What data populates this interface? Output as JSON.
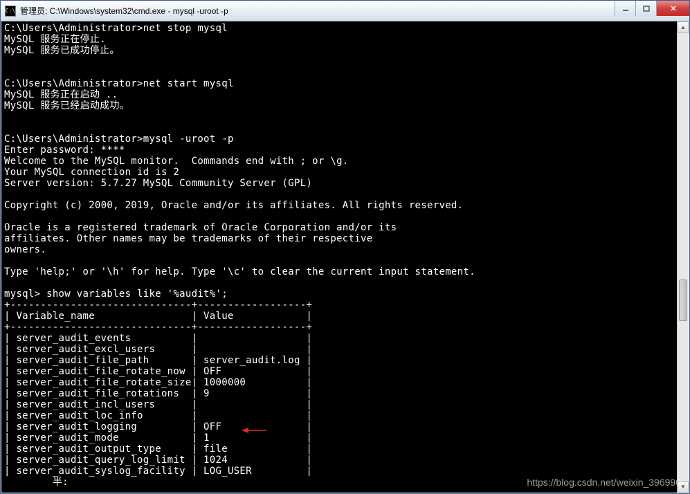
{
  "window": {
    "title": "管理员: C:\\Windows\\system32\\cmd.exe - mysql  -uroot -p",
    "icon_label": "C:\\"
  },
  "console": {
    "lines": [
      "C:\\Users\\Administrator>net stop mysql",
      "MySQL 服务正在停止.",
      "MySQL 服务已成功停止。",
      "",
      "",
      "C:\\Users\\Administrator>net start mysql",
      "MySQL 服务正在启动 ..",
      "MySQL 服务已经启动成功。",
      "",
      "",
      "C:\\Users\\Administrator>mysql -uroot -p",
      "Enter password: ****",
      "Welcome to the MySQL monitor.  Commands end with ; or \\g.",
      "Your MySQL connection id is 2",
      "Server version: 5.7.27 MySQL Community Server (GPL)",
      "",
      "Copyright (c) 2000, 2019, Oracle and/or its affiliates. All rights reserved.",
      "",
      "Oracle is a registered trademark of Oracle Corporation and/or its",
      "affiliates. Other names may be trademarks of their respective",
      "owners.",
      "",
      "Type 'help;' or '\\h' for help. Type '\\c' to clear the current input statement.",
      "",
      "mysql> show variables like '%audit%';",
      "+------------------------------+------------------+",
      "| Variable_name                | Value            |",
      "+------------------------------+------------------+",
      "| server_audit_events          |                  |",
      "| server_audit_excl_users      |                  |",
      "| server_audit_file_path       | server_audit.log |",
      "| server_audit_file_rotate_now | OFF              |",
      "| server_audit_file_rotate_size| 1000000          |",
      "| server_audit_file_rotations  | 9                |",
      "| server_audit_incl_users      |                  |",
      "| server_audit_loc_info        |                  |",
      "| server_audit_logging         | OFF              |",
      "| server_audit_mode            | 1                |",
      "| server_audit_output_type     | file             |",
      "| server_audit_query_log_limit | 1024             |",
      "| server_audit_syslog_facility | LOG_USER         |",
      "        半:"
    ]
  },
  "watermark": "https://blog.csdn.net/weixin_396990",
  "annotation": {
    "arrow_target": "server_audit_logging OFF"
  }
}
